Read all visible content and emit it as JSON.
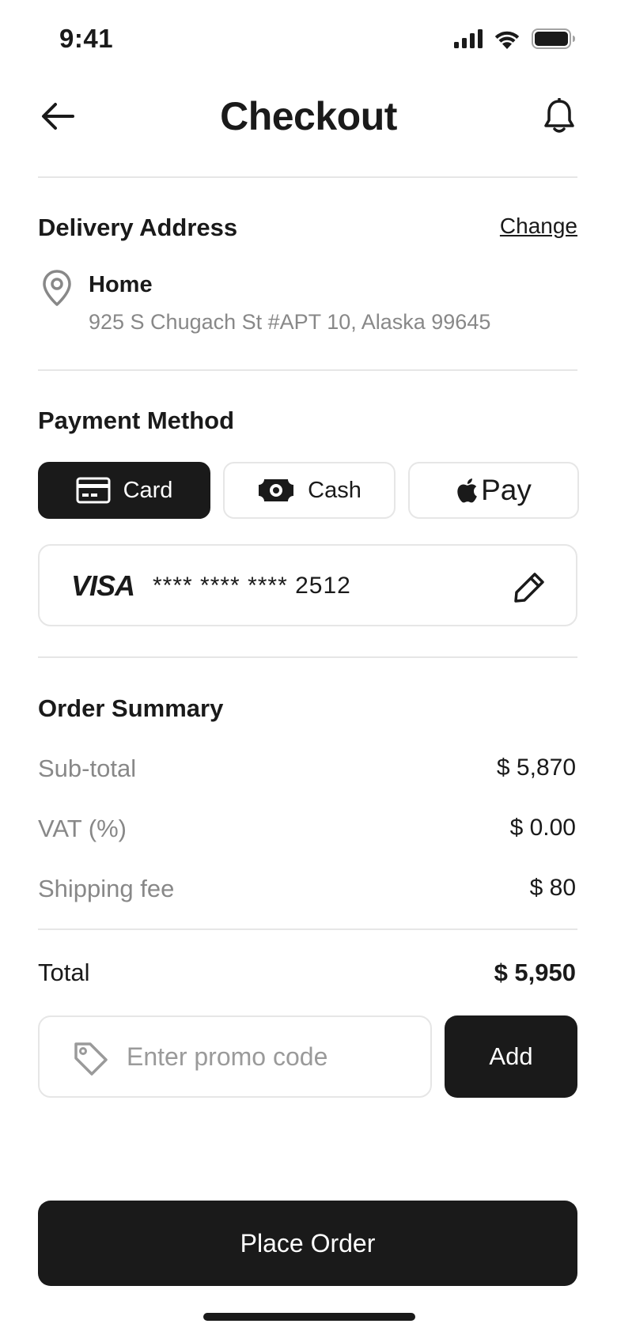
{
  "status_bar": {
    "time": "9:41",
    "icons": [
      "signal-icon",
      "wifi-icon",
      "battery-icon"
    ]
  },
  "header": {
    "title": "Checkout",
    "back_icon": "arrow-left-icon",
    "bell_icon": "bell-icon"
  },
  "delivery": {
    "title": "Delivery Address",
    "change_label": "Change",
    "icon": "location-pin-icon",
    "address_name": "Home",
    "address_line": "925 S Chugach St #APT 10, Alaska 99645"
  },
  "payment": {
    "title": "Payment Method",
    "tabs": [
      {
        "label": "Card",
        "icon": "credit-card-icon",
        "selected": true
      },
      {
        "label": "Cash",
        "icon": "cash-icon",
        "selected": false
      },
      {
        "label": "Pay",
        "icon": "apple-logo-icon",
        "selected": false
      }
    ],
    "card_brand": "VISA",
    "card_number": "**** **** **** 2512",
    "edit_icon": "pencil-icon"
  },
  "summary": {
    "title": "Order Summary",
    "rows": [
      {
        "label": "Sub-total",
        "value": "$ 5,870"
      },
      {
        "label": "VAT (%)",
        "value": "$ 0.00"
      },
      {
        "label": "Shipping fee",
        "value": "$ 80"
      }
    ],
    "total_label": "Total",
    "total_value": "$ 5,950"
  },
  "promo": {
    "placeholder": "Enter promo code",
    "icon": "tag-icon",
    "add_label": "Add"
  },
  "place_order_label": "Place Order",
  "colors": {
    "primary": "#1a1a1a",
    "muted": "#888888",
    "border": "#e6e6e6",
    "background": "#ffffff"
  }
}
